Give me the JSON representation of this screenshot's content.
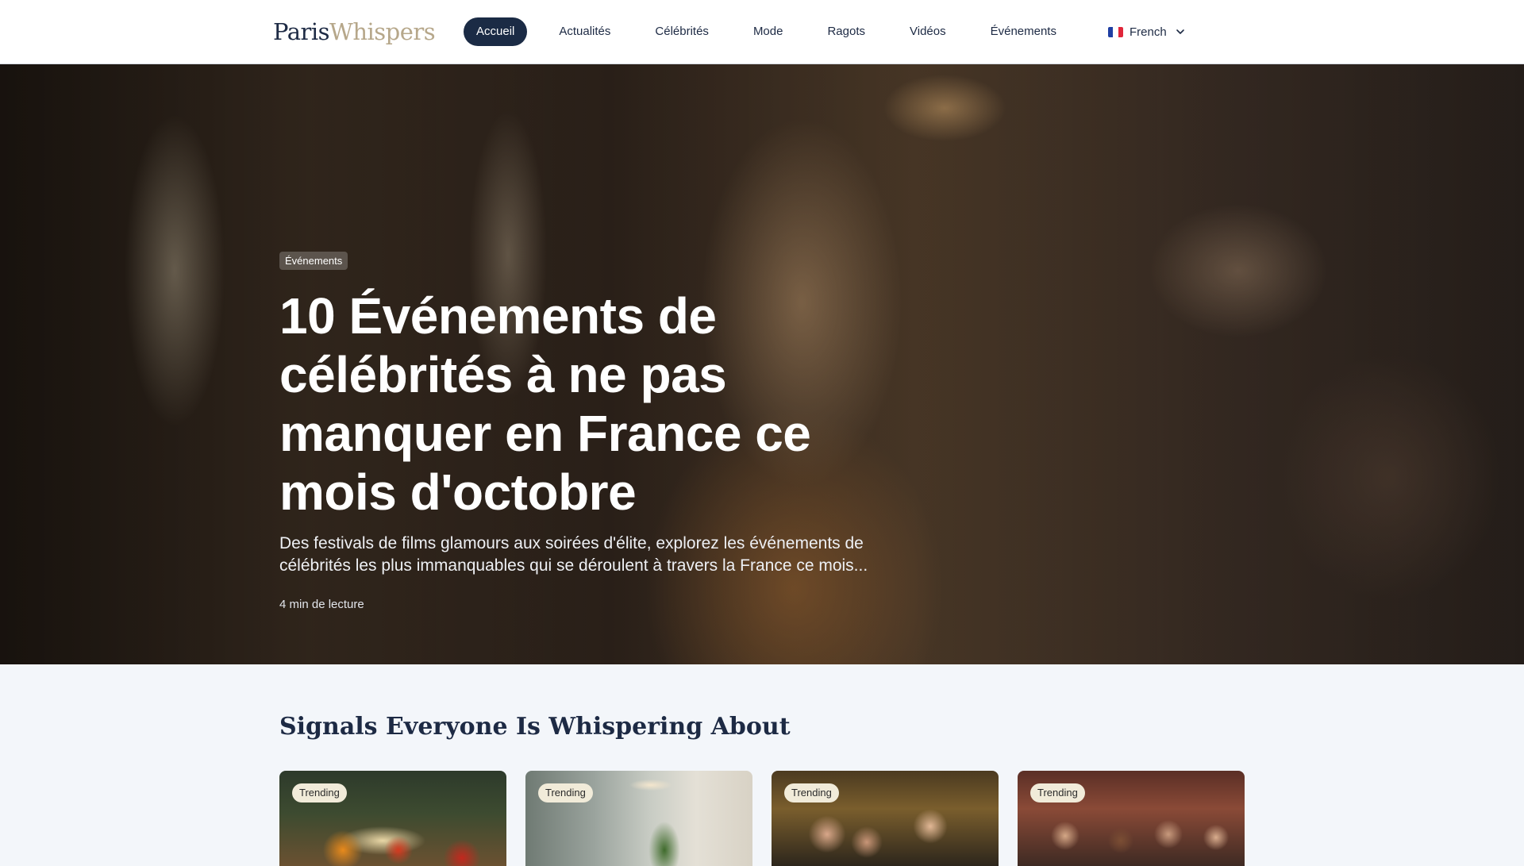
{
  "header": {
    "logo": {
      "part1": "Paris",
      "part2": "Whispers"
    },
    "nav": [
      {
        "label": "Accueil",
        "active": true
      },
      {
        "label": "Actualités",
        "active": false
      },
      {
        "label": "Célébrités",
        "active": false
      },
      {
        "label": "Mode",
        "active": false
      },
      {
        "label": "Ragots",
        "active": false
      },
      {
        "label": "Vidéos",
        "active": false
      },
      {
        "label": "Événements",
        "active": false
      }
    ],
    "language": {
      "label": "French",
      "flag_icon": "france-flag-icon",
      "chevron_icon": "chevron-down-icon"
    }
  },
  "hero": {
    "category": "Événements",
    "title": "10 Événements de célébrités à ne pas manquer en France ce mois d'octobre",
    "description": "Des festivals de films glamours aux soirées d'élite, explorez les événements de célébrités les plus immanquables qui se déroulent à travers la France ce mois...",
    "read_time": "4 min de lecture"
  },
  "trending": {
    "title": "Signals Everyone Is Whispering About",
    "cards": [
      {
        "badge": "Trending"
      },
      {
        "badge": "Trending"
      },
      {
        "badge": "Trending"
      },
      {
        "badge": "Trending"
      }
    ]
  },
  "colors": {
    "primary": "#1b2b45",
    "background": "#f3f6fa",
    "badge_bg": "#f1ebd9",
    "logo_accent": "#b6a78a"
  }
}
